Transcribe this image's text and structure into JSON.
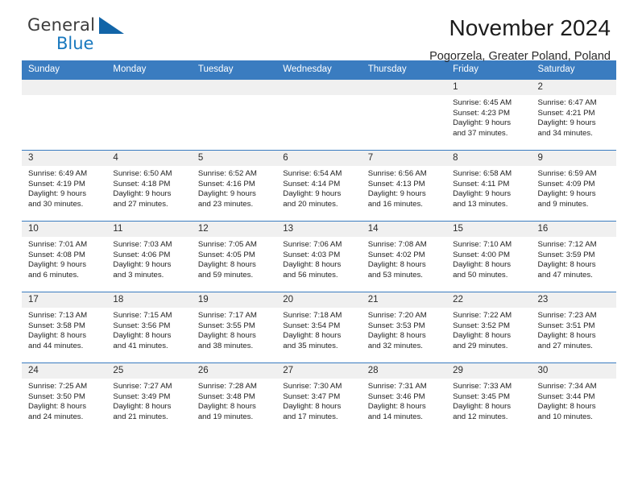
{
  "brand": {
    "name_top": "General",
    "name_bottom": "Blue",
    "accent_color": "#1878be",
    "triangle_color": "#1265a8"
  },
  "header": {
    "title": "November 2024",
    "subtitle": "Pogorzela, Greater Poland, Poland"
  },
  "theme": {
    "header_bg": "#3a7cc0",
    "daynum_bg": "#f0f0f0",
    "rule_color": "#3a7cc0"
  },
  "weekdays": [
    "Sunday",
    "Monday",
    "Tuesday",
    "Wednesday",
    "Thursday",
    "Friday",
    "Saturday"
  ],
  "labels": {
    "sunrise_prefix": "Sunrise:",
    "sunset_prefix": "Sunset:",
    "daylight_prefix": "Daylight:"
  },
  "weeks": [
    [
      {
        "day": "",
        "empty": true
      },
      {
        "day": "",
        "empty": true
      },
      {
        "day": "",
        "empty": true
      },
      {
        "day": "",
        "empty": true
      },
      {
        "day": "",
        "empty": true
      },
      {
        "day": "1",
        "sunrise": "Sunrise: 6:45 AM",
        "sunset": "Sunset: 4:23 PM",
        "daylight_line1": "Daylight: 9 hours",
        "daylight_line2": "and 37 minutes."
      },
      {
        "day": "2",
        "sunrise": "Sunrise: 6:47 AM",
        "sunset": "Sunset: 4:21 PM",
        "daylight_line1": "Daylight: 9 hours",
        "daylight_line2": "and 34 minutes."
      }
    ],
    [
      {
        "day": "3",
        "sunrise": "Sunrise: 6:49 AM",
        "sunset": "Sunset: 4:19 PM",
        "daylight_line1": "Daylight: 9 hours",
        "daylight_line2": "and 30 minutes."
      },
      {
        "day": "4",
        "sunrise": "Sunrise: 6:50 AM",
        "sunset": "Sunset: 4:18 PM",
        "daylight_line1": "Daylight: 9 hours",
        "daylight_line2": "and 27 minutes."
      },
      {
        "day": "5",
        "sunrise": "Sunrise: 6:52 AM",
        "sunset": "Sunset: 4:16 PM",
        "daylight_line1": "Daylight: 9 hours",
        "daylight_line2": "and 23 minutes."
      },
      {
        "day": "6",
        "sunrise": "Sunrise: 6:54 AM",
        "sunset": "Sunset: 4:14 PM",
        "daylight_line1": "Daylight: 9 hours",
        "daylight_line2": "and 20 minutes."
      },
      {
        "day": "7",
        "sunrise": "Sunrise: 6:56 AM",
        "sunset": "Sunset: 4:13 PM",
        "daylight_line1": "Daylight: 9 hours",
        "daylight_line2": "and 16 minutes."
      },
      {
        "day": "8",
        "sunrise": "Sunrise: 6:58 AM",
        "sunset": "Sunset: 4:11 PM",
        "daylight_line1": "Daylight: 9 hours",
        "daylight_line2": "and 13 minutes."
      },
      {
        "day": "9",
        "sunrise": "Sunrise: 6:59 AM",
        "sunset": "Sunset: 4:09 PM",
        "daylight_line1": "Daylight: 9 hours",
        "daylight_line2": "and 9 minutes."
      }
    ],
    [
      {
        "day": "10",
        "sunrise": "Sunrise: 7:01 AM",
        "sunset": "Sunset: 4:08 PM",
        "daylight_line1": "Daylight: 9 hours",
        "daylight_line2": "and 6 minutes."
      },
      {
        "day": "11",
        "sunrise": "Sunrise: 7:03 AM",
        "sunset": "Sunset: 4:06 PM",
        "daylight_line1": "Daylight: 9 hours",
        "daylight_line2": "and 3 minutes."
      },
      {
        "day": "12",
        "sunrise": "Sunrise: 7:05 AM",
        "sunset": "Sunset: 4:05 PM",
        "daylight_line1": "Daylight: 8 hours",
        "daylight_line2": "and 59 minutes."
      },
      {
        "day": "13",
        "sunrise": "Sunrise: 7:06 AM",
        "sunset": "Sunset: 4:03 PM",
        "daylight_line1": "Daylight: 8 hours",
        "daylight_line2": "and 56 minutes."
      },
      {
        "day": "14",
        "sunrise": "Sunrise: 7:08 AM",
        "sunset": "Sunset: 4:02 PM",
        "daylight_line1": "Daylight: 8 hours",
        "daylight_line2": "and 53 minutes."
      },
      {
        "day": "15",
        "sunrise": "Sunrise: 7:10 AM",
        "sunset": "Sunset: 4:00 PM",
        "daylight_line1": "Daylight: 8 hours",
        "daylight_line2": "and 50 minutes."
      },
      {
        "day": "16",
        "sunrise": "Sunrise: 7:12 AM",
        "sunset": "Sunset: 3:59 PM",
        "daylight_line1": "Daylight: 8 hours",
        "daylight_line2": "and 47 minutes."
      }
    ],
    [
      {
        "day": "17",
        "sunrise": "Sunrise: 7:13 AM",
        "sunset": "Sunset: 3:58 PM",
        "daylight_line1": "Daylight: 8 hours",
        "daylight_line2": "and 44 minutes."
      },
      {
        "day": "18",
        "sunrise": "Sunrise: 7:15 AM",
        "sunset": "Sunset: 3:56 PM",
        "daylight_line1": "Daylight: 8 hours",
        "daylight_line2": "and 41 minutes."
      },
      {
        "day": "19",
        "sunrise": "Sunrise: 7:17 AM",
        "sunset": "Sunset: 3:55 PM",
        "daylight_line1": "Daylight: 8 hours",
        "daylight_line2": "and 38 minutes."
      },
      {
        "day": "20",
        "sunrise": "Sunrise: 7:18 AM",
        "sunset": "Sunset: 3:54 PM",
        "daylight_line1": "Daylight: 8 hours",
        "daylight_line2": "and 35 minutes."
      },
      {
        "day": "21",
        "sunrise": "Sunrise: 7:20 AM",
        "sunset": "Sunset: 3:53 PM",
        "daylight_line1": "Daylight: 8 hours",
        "daylight_line2": "and 32 minutes."
      },
      {
        "day": "22",
        "sunrise": "Sunrise: 7:22 AM",
        "sunset": "Sunset: 3:52 PM",
        "daylight_line1": "Daylight: 8 hours",
        "daylight_line2": "and 29 minutes."
      },
      {
        "day": "23",
        "sunrise": "Sunrise: 7:23 AM",
        "sunset": "Sunset: 3:51 PM",
        "daylight_line1": "Daylight: 8 hours",
        "daylight_line2": "and 27 minutes."
      }
    ],
    [
      {
        "day": "24",
        "sunrise": "Sunrise: 7:25 AM",
        "sunset": "Sunset: 3:50 PM",
        "daylight_line1": "Daylight: 8 hours",
        "daylight_line2": "and 24 minutes."
      },
      {
        "day": "25",
        "sunrise": "Sunrise: 7:27 AM",
        "sunset": "Sunset: 3:49 PM",
        "daylight_line1": "Daylight: 8 hours",
        "daylight_line2": "and 21 minutes."
      },
      {
        "day": "26",
        "sunrise": "Sunrise: 7:28 AM",
        "sunset": "Sunset: 3:48 PM",
        "daylight_line1": "Daylight: 8 hours",
        "daylight_line2": "and 19 minutes."
      },
      {
        "day": "27",
        "sunrise": "Sunrise: 7:30 AM",
        "sunset": "Sunset: 3:47 PM",
        "daylight_line1": "Daylight: 8 hours",
        "daylight_line2": "and 17 minutes."
      },
      {
        "day": "28",
        "sunrise": "Sunrise: 7:31 AM",
        "sunset": "Sunset: 3:46 PM",
        "daylight_line1": "Daylight: 8 hours",
        "daylight_line2": "and 14 minutes."
      },
      {
        "day": "29",
        "sunrise": "Sunrise: 7:33 AM",
        "sunset": "Sunset: 3:45 PM",
        "daylight_line1": "Daylight: 8 hours",
        "daylight_line2": "and 12 minutes."
      },
      {
        "day": "30",
        "sunrise": "Sunrise: 7:34 AM",
        "sunset": "Sunset: 3:44 PM",
        "daylight_line1": "Daylight: 8 hours",
        "daylight_line2": "and 10 minutes."
      }
    ]
  ]
}
